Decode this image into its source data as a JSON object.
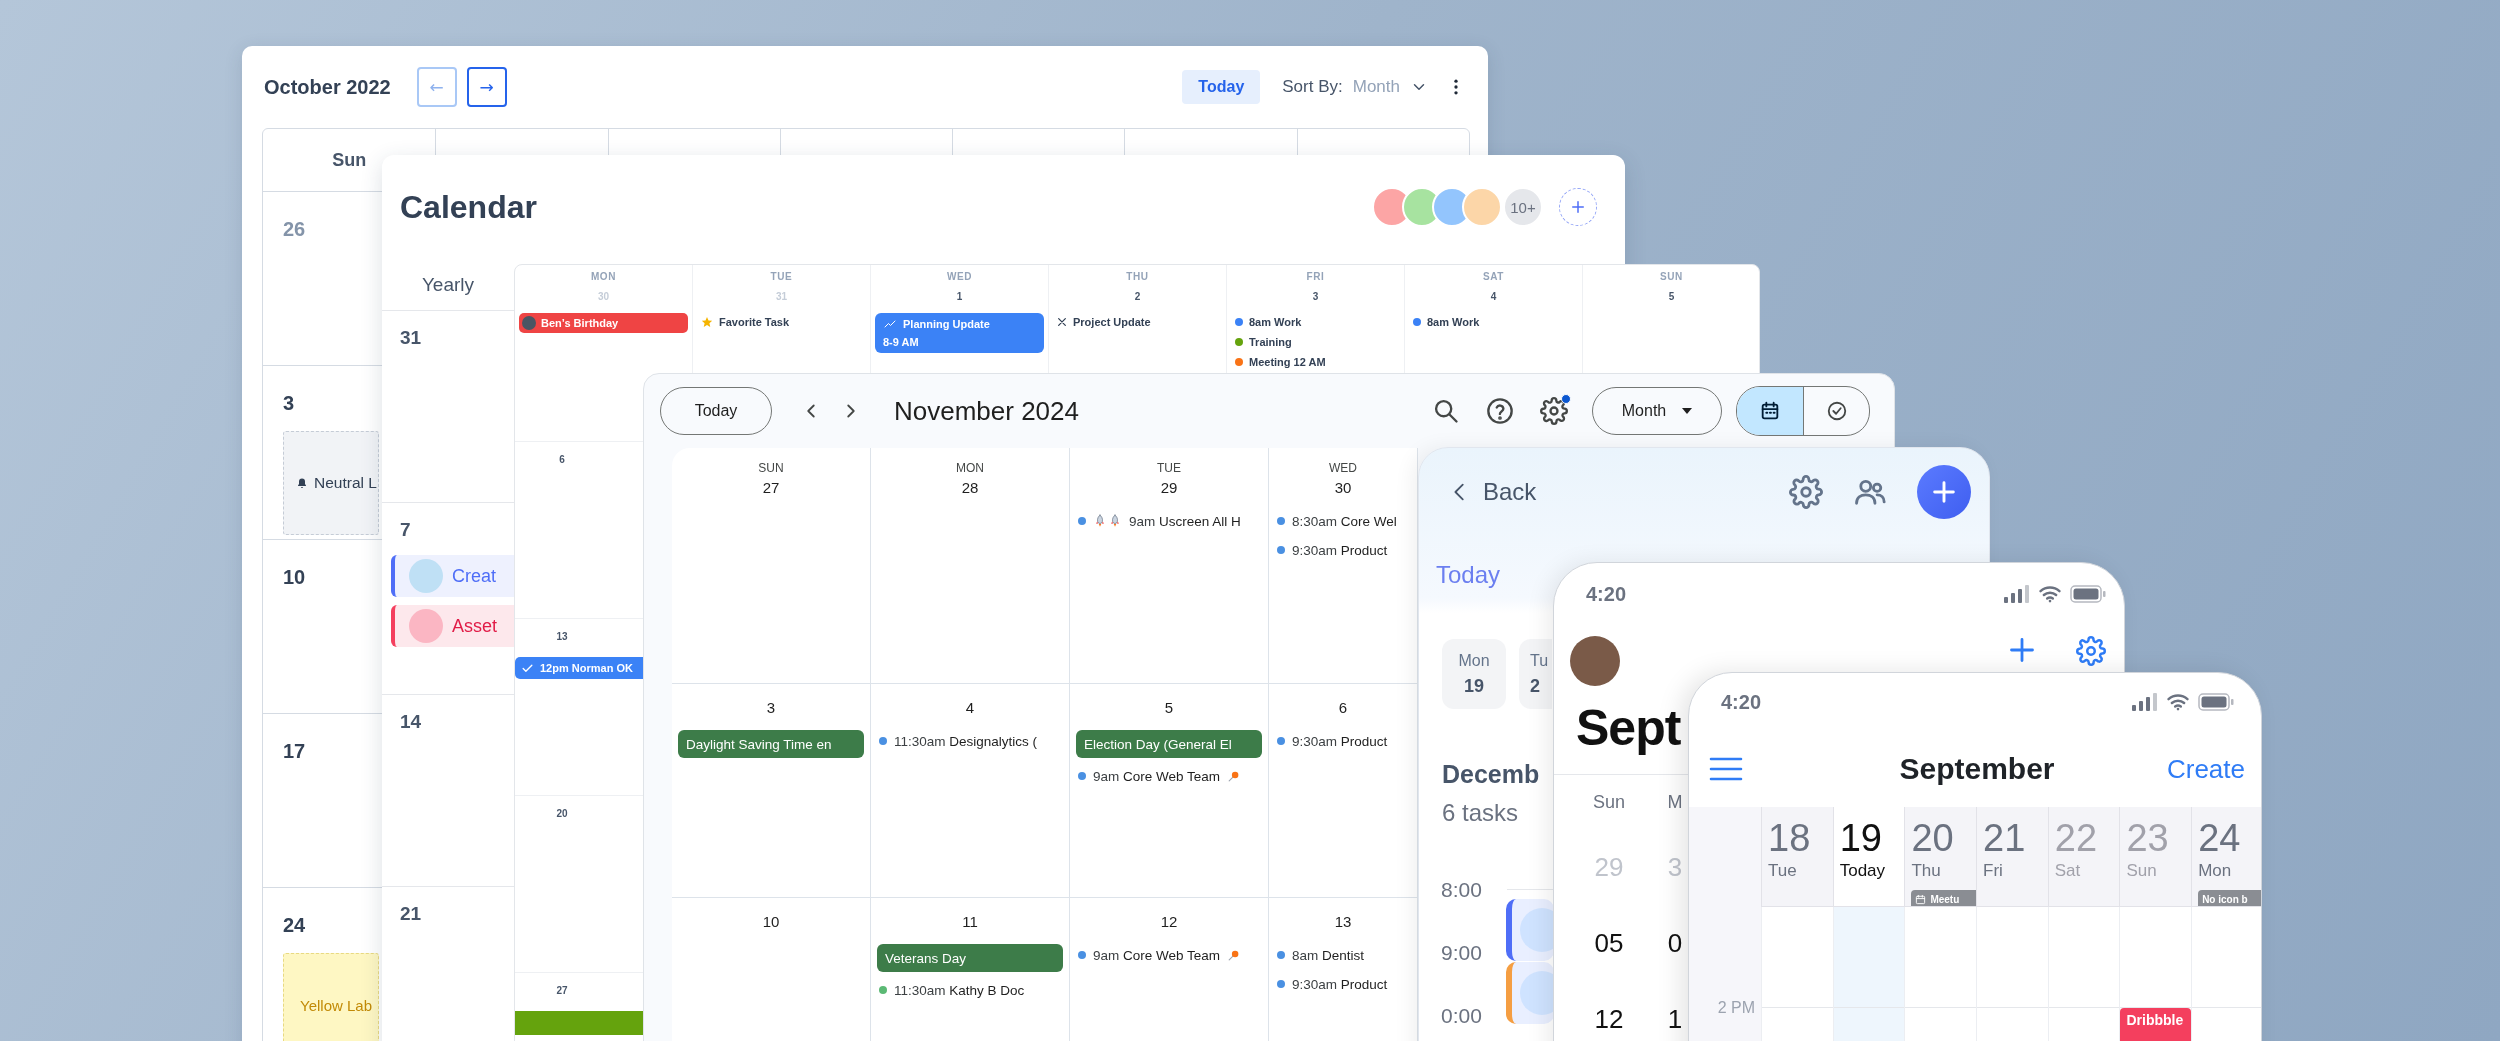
{
  "oct_window": {
    "title": "October 2022",
    "nav": [
      {
        "label": "←",
        "disabled": true
      },
      {
        "label": "→",
        "disabled": false
      }
    ],
    "today": "Today",
    "sort_label": "Sort By:",
    "sort_value": "Month",
    "weekdays": [
      "Sun"
    ],
    "weeks": [
      {
        "day": "26",
        "muted": true
      },
      {
        "day": "3",
        "muted": false,
        "event": {
          "kind": "neutral",
          "text": "Neutral L"
        }
      },
      {
        "day": "10",
        "muted": false
      },
      {
        "day": "17",
        "muted": false
      },
      {
        "day": "24",
        "muted": false,
        "event": {
          "kind": "yellow",
          "text": "Yellow Lab"
        }
      }
    ]
  },
  "calendar_window": {
    "title": "Calendar",
    "more_members": "10+",
    "view": "Yearly",
    "rows": [
      {
        "day": "31"
      },
      {
        "day": "7",
        "events": [
          {
            "kind": "blue",
            "text": "Creat"
          },
          {
            "kind": "red",
            "text": "Asset"
          }
        ]
      },
      {
        "day": "14"
      },
      {
        "day": "21"
      }
    ]
  },
  "week_window": {
    "days": [
      {
        "name": "MON",
        "date": "30",
        "muted": true,
        "events": [
          {
            "kind": "avatar-pill",
            "text": "Ben’s Birthday"
          }
        ]
      },
      {
        "name": "TUE",
        "date": "31",
        "muted": true,
        "events": [
          {
            "kind": "star",
            "text": "Favorite Task"
          }
        ]
      },
      {
        "name": "WED",
        "date": "1",
        "muted": false,
        "events": [
          {
            "kind": "block",
            "text": "Planning Update",
            "detail": "8-9 AM"
          }
        ]
      },
      {
        "name": "THU",
        "date": "2",
        "muted": false,
        "events": [
          {
            "kind": "cross",
            "text": "Project Update"
          }
        ]
      },
      {
        "name": "FRI",
        "date": "3",
        "muted": false,
        "events": [
          {
            "kind": "dot",
            "color": "#3b82f6",
            "text": "8am Work"
          },
          {
            "kind": "dot",
            "color": "#65a30d",
            "text": "Training"
          },
          {
            "kind": "dot",
            "color": "#f97316",
            "text": "Meeting 12 AM"
          }
        ]
      },
      {
        "name": "SAT",
        "date": "4",
        "muted": false,
        "events": [
          {
            "kind": "dot",
            "color": "#3b82f6",
            "text": "8am Work"
          }
        ]
      },
      {
        "name": "SUN",
        "date": "5",
        "muted": false
      }
    ],
    "first_column": [
      {
        "date": "6"
      },
      {
        "date": "13",
        "events": [
          {
            "kind": "check",
            "text": "12pm Norman OK"
          }
        ]
      },
      {
        "date": "20"
      },
      {
        "date": "27",
        "events": [
          {
            "kind": "bar",
            "color": "#65a30d"
          }
        ]
      }
    ]
  },
  "month_window": {
    "today": "Today",
    "title": "November 2024",
    "settings_badge": true,
    "view": "Month",
    "view_modes": [
      {
        "kind": "calendar",
        "selected": true
      },
      {
        "kind": "tasks",
        "selected": false
      }
    ],
    "weekdays": [
      "SUN",
      "MON",
      "TUE",
      "WED"
    ],
    "weeks": [
      {
        "days": [
          {
            "date": "27"
          },
          {
            "date": "28"
          },
          {
            "date": "29",
            "events": [
              {
                "kind": "dot-lead",
                "color": "#4a90e2",
                "time": "9am",
                "title": "Uscreen All H"
              }
            ]
          },
          {
            "date": "30",
            "events": [
              {
                "kind": "dot",
                "color": "#4a90e2",
                "time": "8:30am",
                "title": "Core Wel"
              },
              {
                "kind": "dot",
                "color": "#4a90e2",
                "time": "9:30am",
                "title": "Product"
              }
            ]
          }
        ]
      },
      {
        "days": [
          {
            "date": "3",
            "events": [
              {
                "kind": "chip",
                "title": "Daylight Saving Time en"
              }
            ]
          },
          {
            "date": "4",
            "events": [
              {
                "kind": "dot",
                "color": "#4a90e2",
                "time": "11:30am",
                "title": "Designalytics ("
              }
            ]
          },
          {
            "date": "5",
            "events": [
              {
                "kind": "chip",
                "title": "Election Day (General El"
              },
              {
                "kind": "dot-tail",
                "color": "#4a90e2",
                "time": "9am",
                "title": "Core Web Team"
              }
            ]
          },
          {
            "date": "6",
            "events": [
              {
                "kind": "dot",
                "color": "#4a90e2",
                "time": "9:30am",
                "title": "Product"
              }
            ]
          }
        ]
      },
      {
        "days": [
          {
            "date": "10"
          },
          {
            "date": "11",
            "events": [
              {
                "kind": "chip",
                "title": "Veterans Day"
              },
              {
                "kind": "dot",
                "color": "#5bb974",
                "time": "11:30am",
                "title": "Kathy B Doc"
              }
            ]
          },
          {
            "date": "12",
            "events": [
              {
                "kind": "dot-tail",
                "color": "#4a90e2",
                "time": "9am",
                "title": "Core Web Team"
              }
            ]
          },
          {
            "date": "13",
            "events": [
              {
                "kind": "dot",
                "color": "#4a90e2",
                "time": "8am",
                "title": "Dentist"
              },
              {
                "kind": "dot",
                "color": "#4a90e2",
                "time": "9:30am",
                "title": "Product"
              }
            ]
          }
        ]
      }
    ]
  },
  "tasks_window": {
    "back": "Back",
    "today": "Today",
    "days": [
      {
        "name": "Mon",
        "date": "19"
      },
      {
        "name": "Tu",
        "date": "2"
      }
    ],
    "month": "Decemb",
    "count": "6 tasks",
    "slots": [
      {
        "time": "8:00",
        "card": {
          "color": "#4f6ef7"
        }
      },
      {
        "time": "9:00",
        "card": {
          "color": "#f59e42"
        }
      },
      {
        "time": "0:00"
      }
    ]
  },
  "phone_month": {
    "time": "4:20",
    "title": "Sept",
    "weekdays": [
      "Sun",
      "M"
    ],
    "weeks": [
      {
        "dates": [
          "29",
          "3"
        ],
        "muted": true
      },
      {
        "dates": [
          "05",
          "0"
        ],
        "muted": false
      },
      {
        "dates": [
          "12",
          "1"
        ],
        "muted": false
      }
    ]
  },
  "phone_week": {
    "time": "4:20",
    "title": "September",
    "action": "Create",
    "days": [
      {
        "date": "18",
        "name": "Tue",
        "selected": false,
        "muted": false
      },
      {
        "date": "19",
        "name": "Today",
        "selected": true,
        "muted": false
      },
      {
        "date": "20",
        "name": "Thu",
        "selected": false,
        "muted": false,
        "chip": {
          "kind": "icon",
          "text": "Meetu"
        }
      },
      {
        "date": "21",
        "name": "Fri",
        "selected": false,
        "muted": false
      },
      {
        "date": "22",
        "name": "Sat",
        "selected": false,
        "muted": true
      },
      {
        "date": "23",
        "name": "Sun",
        "selected": false,
        "muted": true,
        "event": {
          "text": "Dribbble"
        }
      },
      {
        "date": "24",
        "name": "Mon",
        "selected": false,
        "muted": false,
        "chip": {
          "kind": "plain",
          "text": "No icon b"
        }
      }
    ],
    "hour": "2 PM"
  }
}
